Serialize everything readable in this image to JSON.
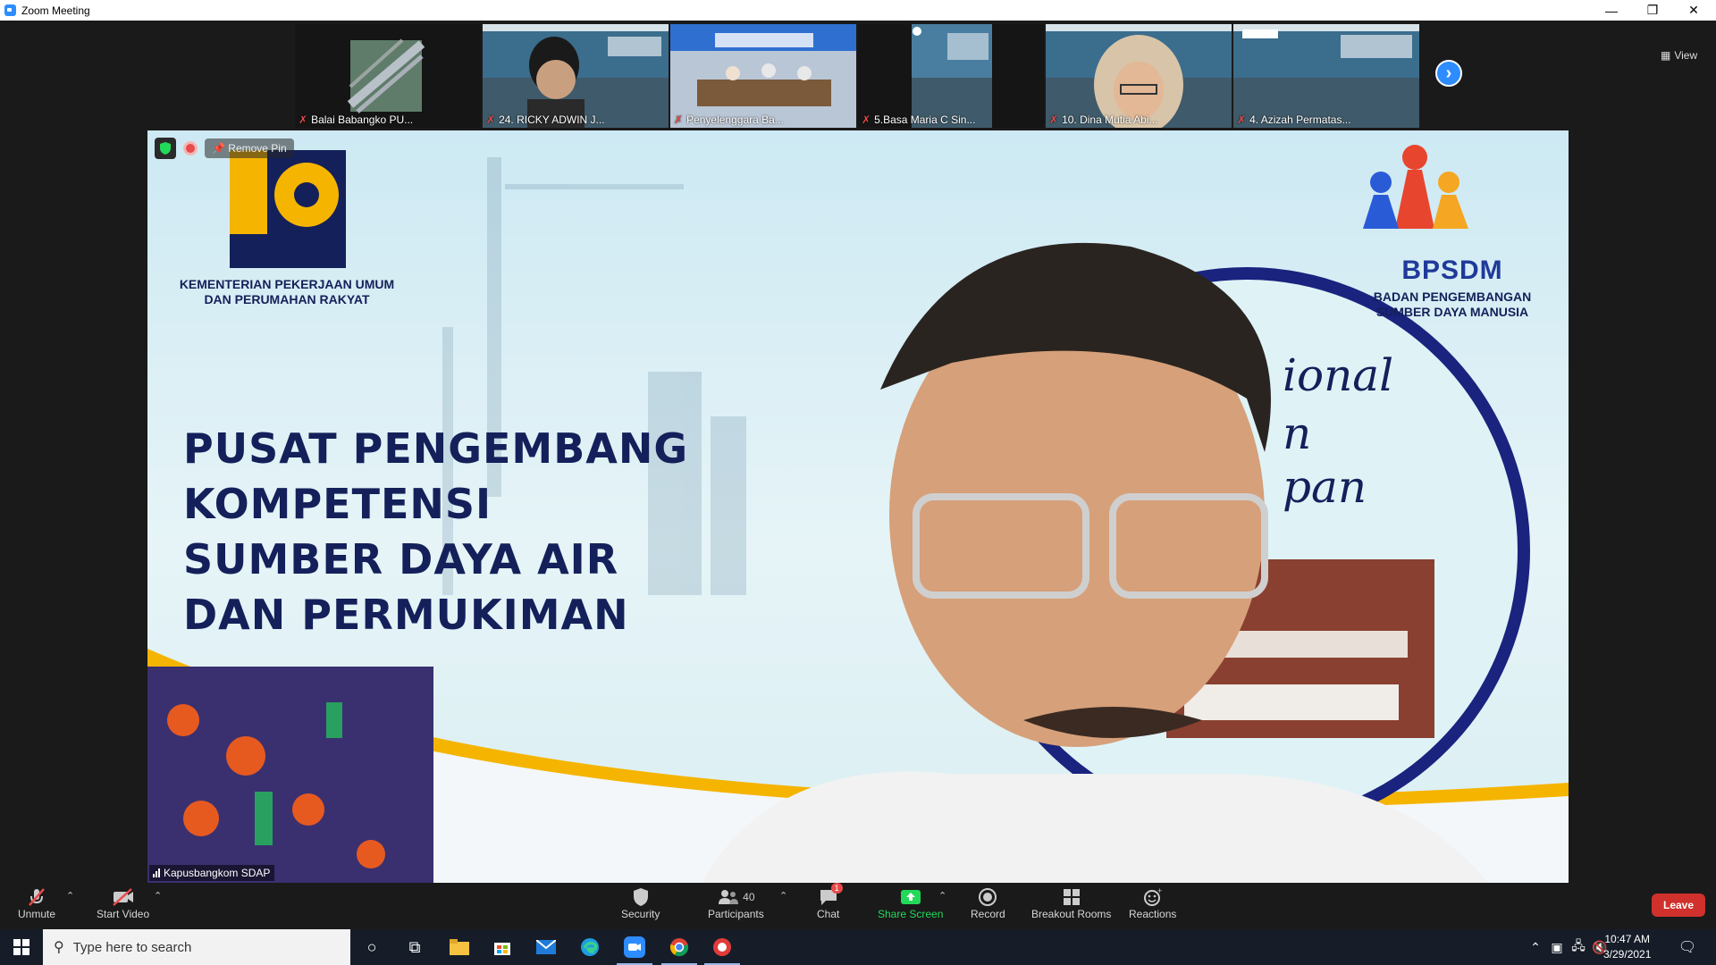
{
  "window": {
    "title": "Zoom Meeting",
    "controls": [
      "—",
      "❐",
      "✕"
    ]
  },
  "gallery": {
    "view_label": "View",
    "thumbnails": [
      {
        "name": "Balai Babangko PU...",
        "muted": true
      },
      {
        "name": "24. RICKY ADWIN J...",
        "muted": true
      },
      {
        "name": "Penyelenggara Ba...",
        "muted": true
      },
      {
        "name": "5.Basa Maria C Sin...",
        "muted": true
      },
      {
        "name": "10. Dina Mutia Abi...",
        "muted": true
      },
      {
        "name": "4. Azizah Permatas...",
        "muted": true
      }
    ]
  },
  "main_video": {
    "remove_pin_label": "Remove Pin",
    "speaker_name": "Kapusbangkom SDAP",
    "slide": {
      "ministry_line1": "KEMENTERIAN PEKERJAAN UMUM",
      "ministry_line2": "DAN PERUMAHAN RAKYAT",
      "title_lines": [
        "PUSAT PENGEMBANG",
        "KOMPETENSI",
        "SUMBER DAYA AIR",
        "DAN PERMUKIMAN"
      ],
      "bpsdm": "BPSDM",
      "bpsdm_sub1": "BADAN PENGEMBANGAN",
      "bpsdm_sub2": "SUMBER DAYA MANUSIA",
      "script_1": "ional",
      "script_2": "n",
      "script_3": "pan"
    }
  },
  "toolbar": {
    "unmute": "Unmute",
    "start_video": "Start Video",
    "security": "Security",
    "participants": "Participants",
    "participants_count": "40",
    "chat": "Chat",
    "chat_badge": "1",
    "share_screen": "Share Screen",
    "record": "Record",
    "breakout_rooms": "Breakout Rooms",
    "reactions": "Reactions",
    "leave": "Leave"
  },
  "taskbar": {
    "search_placeholder": "Type here to search",
    "time": "10:47 AM",
    "date": "3/29/2021"
  },
  "colors": {
    "zoom_blue": "#2d8cff",
    "leave_red": "#d0312d",
    "share_green": "#23d959",
    "slide_navy": "#14205a"
  }
}
